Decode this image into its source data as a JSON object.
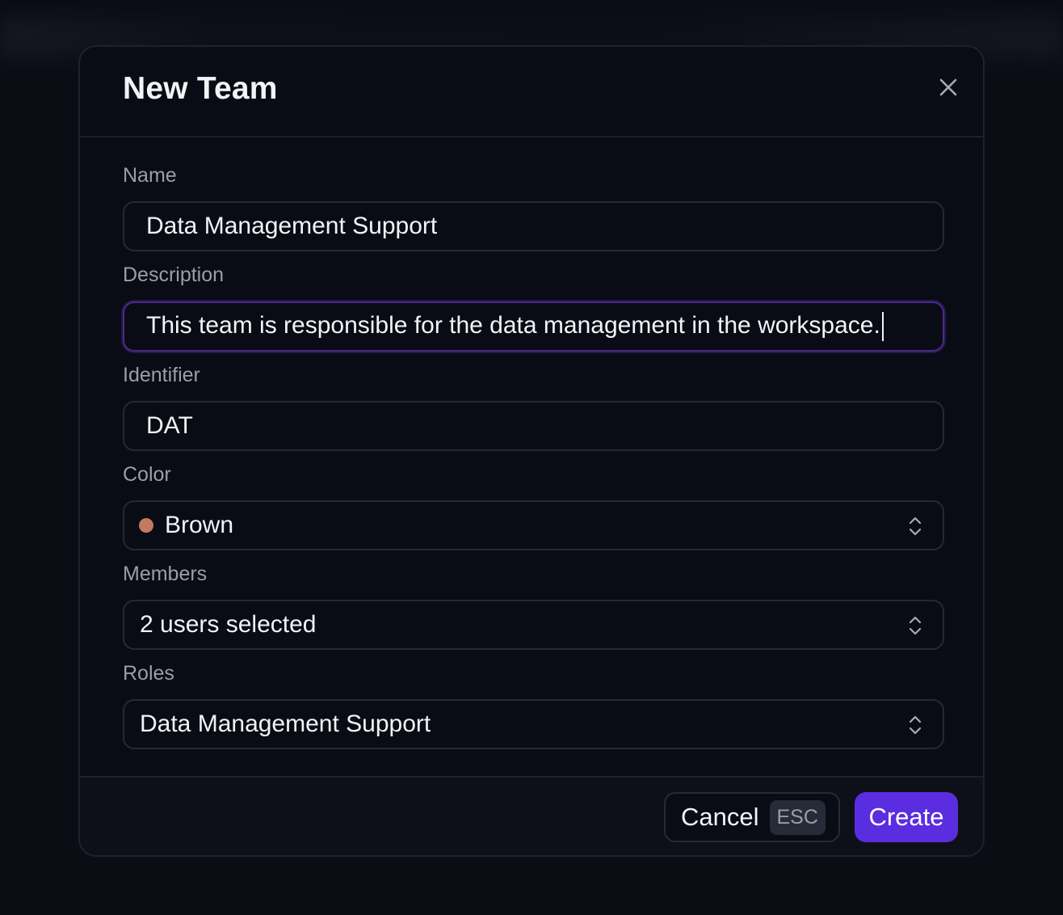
{
  "dialog": {
    "title": "New Team",
    "close_icon": "close-icon"
  },
  "form": {
    "name": {
      "label": "Name",
      "value": "Data Management Support"
    },
    "description": {
      "label": "Description",
      "value": "This team is responsible for the data management in the workspace."
    },
    "identifier": {
      "label": "Identifier",
      "value": "DAT"
    },
    "color": {
      "label": "Color",
      "value": "Brown",
      "swatch": "#c27b5e"
    },
    "members": {
      "label": "Members",
      "value": "2 users selected"
    },
    "roles": {
      "label": "Roles",
      "value": "Data Management Support"
    }
  },
  "footer": {
    "cancel_label": "Cancel",
    "cancel_shortcut": "ESC",
    "create_label": "Create",
    "accent": "#5b2de0"
  }
}
